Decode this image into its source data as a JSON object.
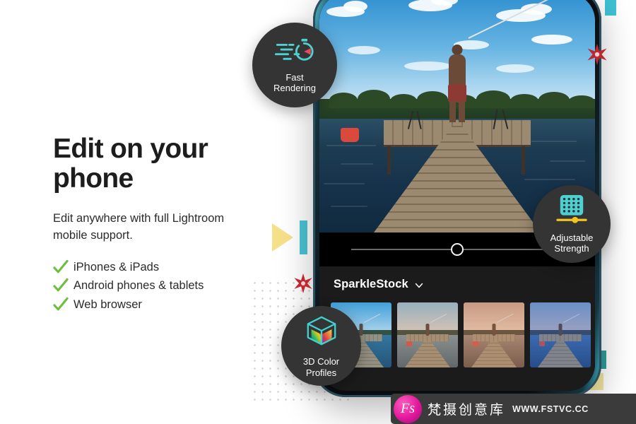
{
  "left_panel": {
    "headline": "Edit on your phone",
    "subcopy": "Edit anywhere with full Lightroom mobile support.",
    "features": [
      {
        "label": "iPhones & iPads",
        "icon": "check-icon"
      },
      {
        "label": "Android phones & tablets",
        "icon": "check-icon"
      },
      {
        "label": "Web browser",
        "icon": "check-icon"
      }
    ],
    "check_color": "#6BBE3E",
    "text_color": "#2b2b2b"
  },
  "badges": [
    {
      "id": "fast-rendering",
      "line1": "Fast",
      "line2": "Rendering",
      "icon": "speed-stopwatch-icon",
      "accent": "#4fd0d0",
      "accent2": "#e8495f"
    },
    {
      "id": "adjustable-strength",
      "line1": "Adjustable",
      "line2": "Strength",
      "icon": "dot-grid-slider-icon",
      "accent": "#4fd0d0",
      "accent2": "#f2c51e"
    },
    {
      "id": "3d-color-profiles",
      "line1": "3D Color",
      "line2": "Profiles",
      "icon": "color-cube-icon",
      "accent": "#3fd2d2"
    }
  ],
  "phone_screen": {
    "photo_alt": "Fisherman standing on a wooden dock at a lake",
    "slider": {
      "name": "strength-slider",
      "value": 50,
      "min": 0,
      "max": 100
    },
    "presets_panel": {
      "brand": "SparkleStock",
      "chevron": "chevron-down-icon",
      "thumbnails": [
        {
          "name": "preset-thumb-1",
          "tint": "rgba(90,170,220,0.16)",
          "sky_top": "#3e9fd8",
          "sky_bottom": "#bcdcf0",
          "water_top": "#2f6d94",
          "water_bottom": "#1b4566"
        },
        {
          "name": "preset-thumb-2",
          "tint": "rgba(190,150,120,0.20)",
          "sky_top": "#8fb6cf",
          "sky_bottom": "#d9cfc4",
          "water_top": "#7d8f96",
          "water_bottom": "#4c5c66"
        },
        {
          "name": "preset-thumb-3",
          "tint": "rgba(210,150,110,0.26)",
          "sky_top": "#c79b8e",
          "sky_bottom": "#e8cbb4",
          "water_top": "#9a8073",
          "water_bottom": "#5d4a42"
        },
        {
          "name": "preset-thumb-4",
          "tint": "rgba(60,110,200,0.30)",
          "sky_top": "#7f9ec4",
          "sky_bottom": "#c6b8c0",
          "water_top": "#3a6aa8",
          "water_bottom": "#20406e"
        }
      ]
    }
  },
  "decorations": [
    {
      "name": "yellow-triangle",
      "color": "#f7e08a"
    },
    {
      "name": "teal-bar-left",
      "color": "#49c5d6"
    },
    {
      "name": "red-star-top-right",
      "color": "#c0262f"
    },
    {
      "name": "red-star-mid-left",
      "color": "#c0262f"
    },
    {
      "name": "teal-rect-bottom-right",
      "color": "#2f9d9d"
    },
    {
      "name": "yellow-rect-bottom-right",
      "color": "#f2e6a0"
    },
    {
      "name": "dot-grid",
      "color": "#d8d8d8"
    }
  ],
  "watermark": {
    "logo_text": "Fs",
    "brand_cn": "梵摄创意库",
    "url": "WWW.FSTVC.CC"
  }
}
